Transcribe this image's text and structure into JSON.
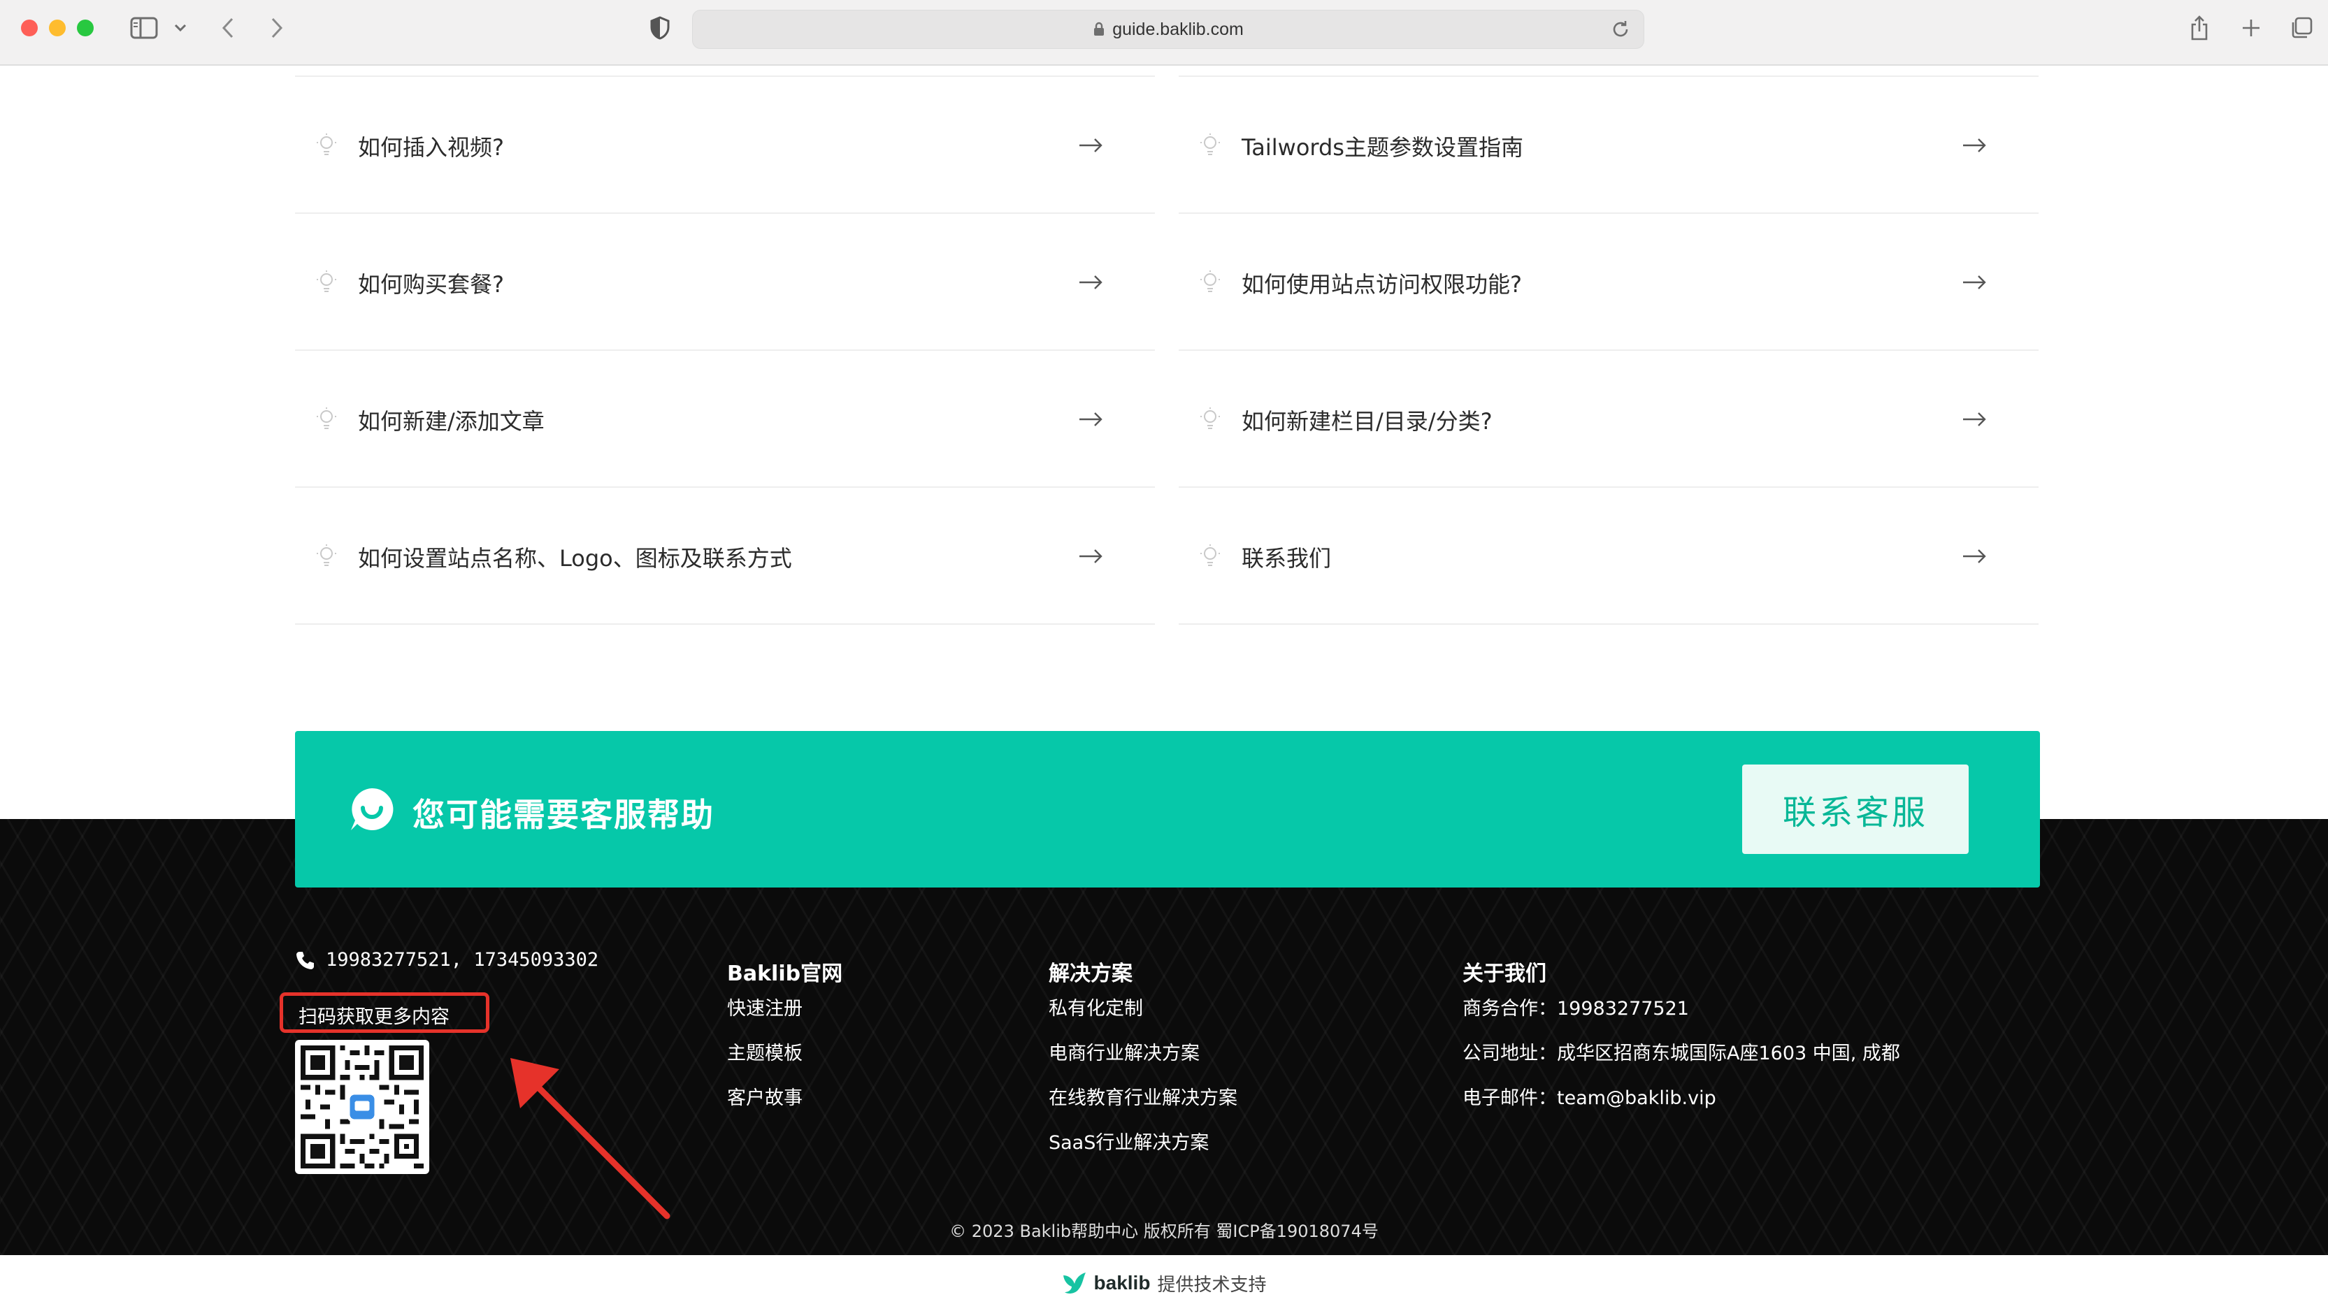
{
  "browser": {
    "url": "guide.baklib.com"
  },
  "faq": {
    "left": [
      {
        "label": "如何插入视频?"
      },
      {
        "label": "如何购买套餐?"
      },
      {
        "label": "如何新建/添加文章"
      },
      {
        "label": "如何设置站点名称、Logo、图标及联系方式"
      }
    ],
    "right": [
      {
        "label": "Tailwords主题参数设置指南"
      },
      {
        "label": "如何使用站点访问权限功能?"
      },
      {
        "label": "如何新建栏目/目录/分类?"
      },
      {
        "label": "联系我们"
      }
    ]
  },
  "cta": {
    "text": "您可能需要客服帮助",
    "button": "联系客服"
  },
  "footer": {
    "phone": "19983277521, 17345093302",
    "scan_label": "扫码获取更多内容",
    "baklib": {
      "title": "Baklib官网",
      "items": [
        "快速注册",
        "主题模板",
        "客户故事"
      ]
    },
    "solutions": {
      "title": "解决方案",
      "items": [
        "私有化定制",
        "电商行业解决方案",
        "在线教育行业解决方案",
        "SaaS行业解决方案"
      ]
    },
    "about": {
      "title": "关于我们",
      "items": [
        "商务合作：19983277521",
        "公司地址：成华区招商东城国际A座1603 中国, 成都",
        "电子邮件：team@baklib.vip"
      ]
    },
    "copyright": "© 2023 Baklib帮助中心 版权所有 蜀ICP备19018074号"
  },
  "powered": {
    "brand": "baklib",
    "text": "提供技术支持"
  },
  "colors": {
    "accent": "#06c8a9",
    "cta_button_bg": "#e8faf5",
    "cta_button_text": "#07b797",
    "footer_bg": "#0b0b0b",
    "annotation": "#e6322a"
  },
  "icons": {
    "faq_item": "lightbulb-icon",
    "faq_link": "arrow-right-icon",
    "cta": "chat-smile-icon",
    "phone": "phone-icon",
    "powered": "bird-logo-icon"
  }
}
